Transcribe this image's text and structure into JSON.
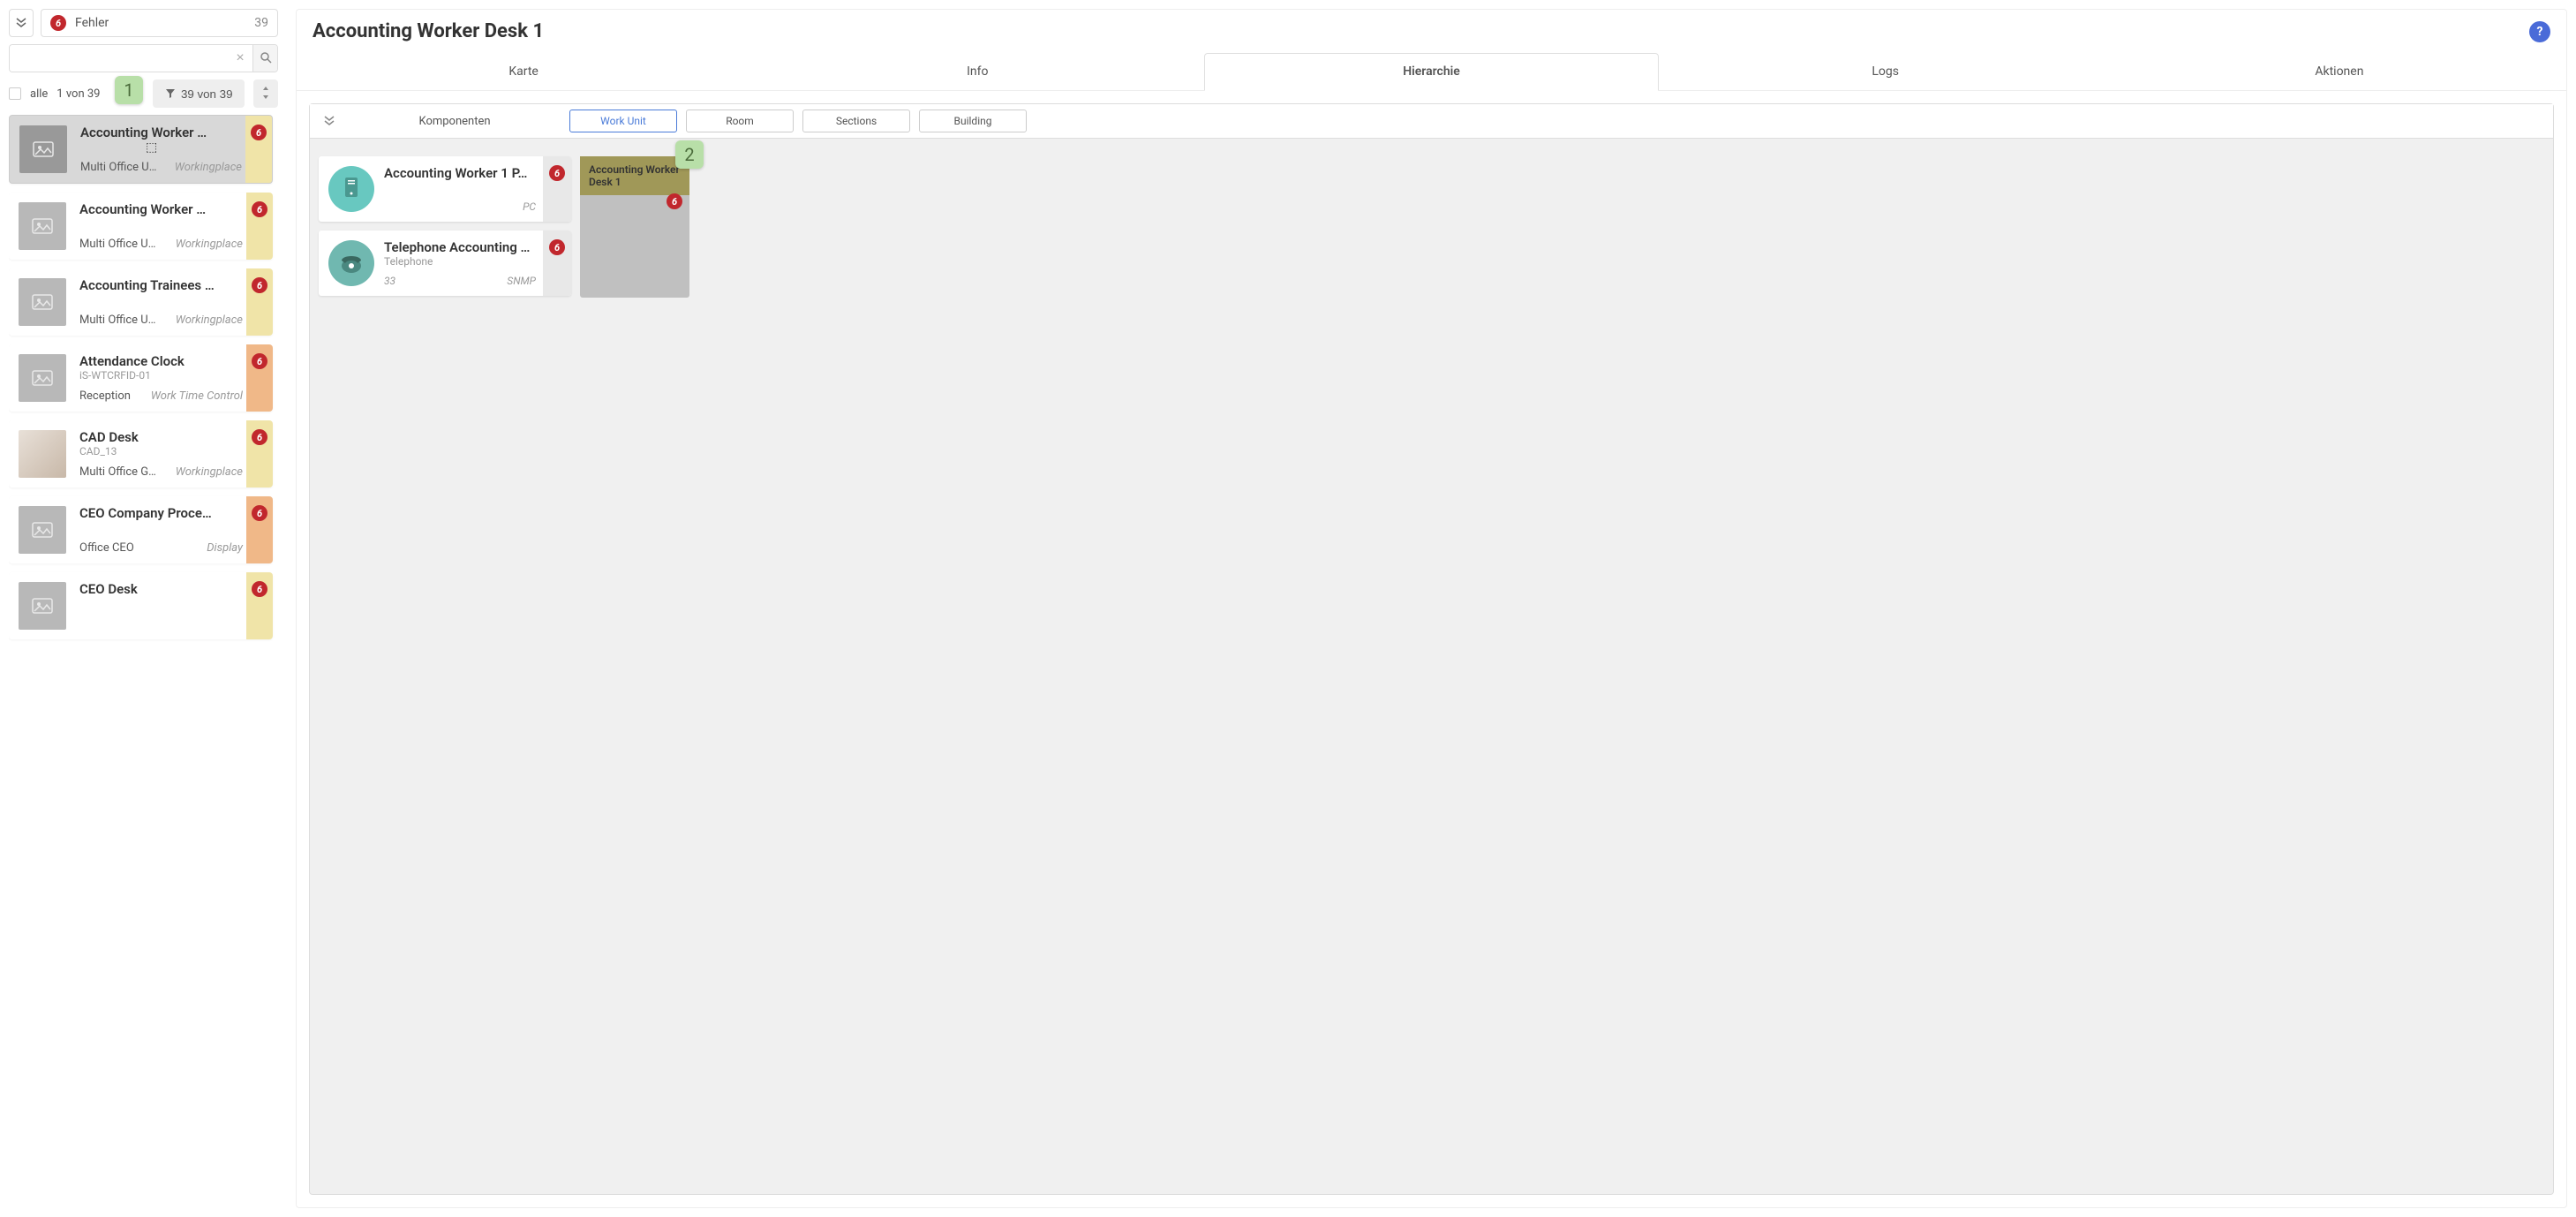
{
  "sidebar": {
    "filter_chip": {
      "label": "Fehler",
      "count": "39",
      "badge": "6"
    },
    "alle_label": "alle",
    "counter": "1 von 39",
    "filter_button": "39 von 39",
    "items": [
      {
        "title": "Accounting Worker …",
        "sub": "",
        "loc": "Multi Office U…",
        "type": "Workingplace",
        "badge": "6",
        "stripe": "stripe-yellow",
        "selected": true,
        "photo": false
      },
      {
        "title": "Accounting Worker …",
        "sub": "",
        "loc": "Multi Office U…",
        "type": "Workingplace",
        "badge": "6",
        "stripe": "stripe-yellow",
        "selected": false,
        "photo": false
      },
      {
        "title": "Accounting Trainees …",
        "sub": "",
        "loc": "Multi Office U…",
        "type": "Workingplace",
        "badge": "6",
        "stripe": "stripe-yellow",
        "selected": false,
        "photo": false
      },
      {
        "title": "Attendance Clock",
        "sub": "iS-WTCRFID-01",
        "loc": "Reception",
        "type": "Work Time Control",
        "badge": "6",
        "stripe": "stripe-orange",
        "selected": false,
        "photo": false
      },
      {
        "title": "CAD Desk",
        "sub": "CAD_13",
        "loc": "Multi Office G…",
        "type": "Workingplace",
        "badge": "6",
        "stripe": "stripe-yellow",
        "selected": false,
        "photo": true
      },
      {
        "title": "CEO Company Proce…",
        "sub": "",
        "loc": "Office CEO",
        "type": "Display",
        "badge": "6",
        "stripe": "stripe-orange",
        "selected": false,
        "photo": false
      },
      {
        "title": "CEO Desk",
        "sub": "",
        "loc": "",
        "type": "",
        "badge": "6",
        "stripe": "stripe-yellow",
        "selected": false,
        "photo": false
      }
    ]
  },
  "main": {
    "title": "Accounting Worker Desk 1",
    "tabs": [
      "Karte",
      "Info",
      "Hierarchie",
      "Logs",
      "Aktionen"
    ],
    "active_tab": 2,
    "hierarchy": {
      "komponenten_label": "Komponenten",
      "level_tabs": [
        "Work Unit",
        "Room",
        "Sections",
        "Building"
      ],
      "active_level": 0,
      "components": [
        {
          "title": "Accounting Worker 1 P…",
          "sub": "",
          "num": "",
          "type": "PC",
          "badge": "6",
          "icon": "pc"
        },
        {
          "title": "Telephone Accounting …",
          "sub": "Telephone",
          "num": "33",
          "type": "SNMP",
          "badge": "6",
          "icon": "phone"
        }
      ],
      "work_unit": {
        "title": "Accounting Worker Desk 1",
        "badge": "6"
      }
    }
  },
  "callouts": {
    "c1": "1",
    "c2": "2"
  }
}
